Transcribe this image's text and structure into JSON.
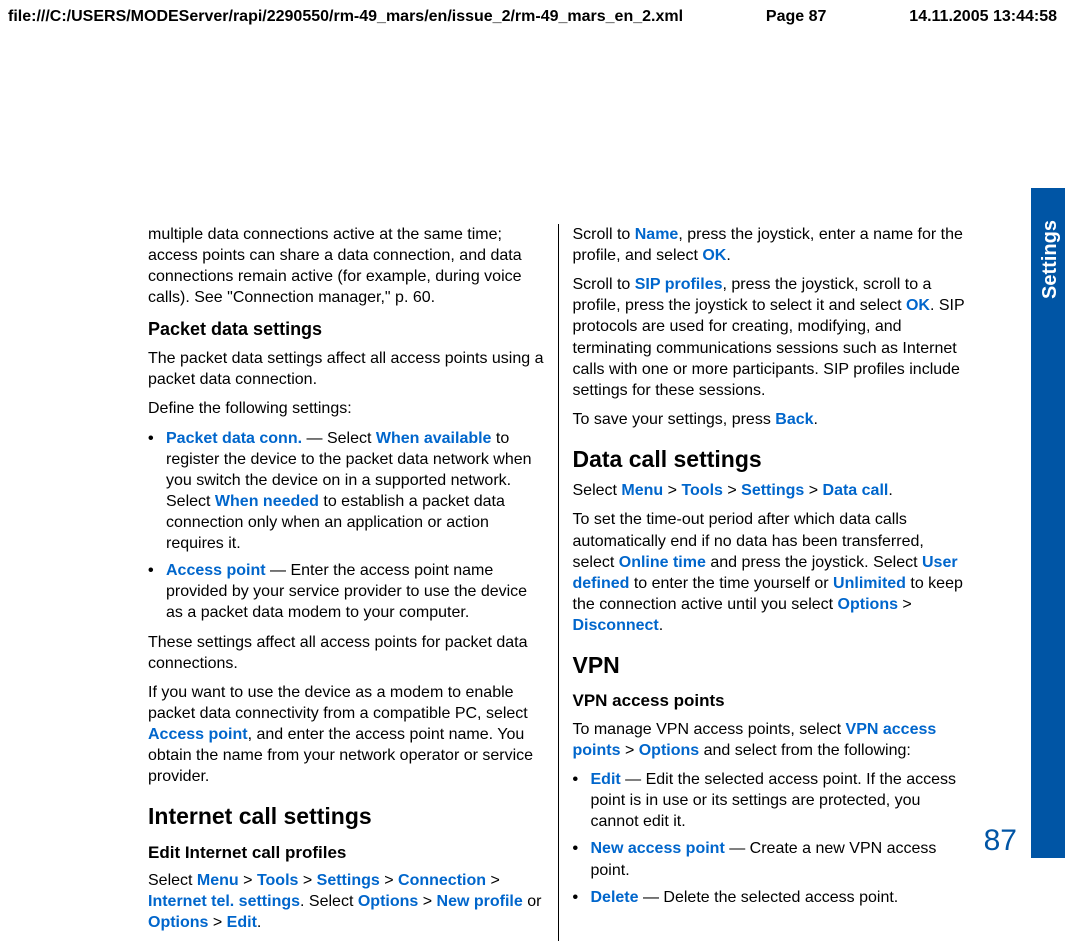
{
  "header": {
    "path": "file:///C:/USERS/MODEServer/rapi/2290550/rm-49_mars/en/issue_2/rm-49_mars_en_2.xml",
    "page": "Page 87",
    "ts": "14.11.2005 13:44:58"
  },
  "side": {
    "tab": "Settings",
    "num": "87"
  },
  "L": {
    "p1": "multiple data connections active at the same time; access points can share a data connection, and data connections remain active (for example, during voice calls). See \"Connection manager,\" p. 60.",
    "h3_pds": "Packet data settings",
    "p2": "The packet data settings affect all access points using a packet data connection.",
    "p3": "Define the following settings:",
    "li1a": "Packet data conn.",
    "li1b": " — Select ",
    "li1c": "When available",
    "li1d": " to register the device to the packet data network when you switch the device on in a supported network. Select ",
    "li1e": "When needed",
    "li1f": " to establish a packet data connection only when an application or action requires it.",
    "li2a": "Access point",
    "li2b": " — Enter the access point name provided by your service provider to use the device as a packet data modem to your computer.",
    "p4": "These settings affect all access points for packet data connections.",
    "p5a": "If you want to use the device as a modem to enable packet data connectivity from a compatible PC, select ",
    "p5b": "Access point",
    "p5c": ", and enter the access point name. You obtain the name from your network operator or service provider.",
    "h2_ics": "Internet call settings",
    "h4_eicp": "Edit Internet call profiles",
    "p6a": "Select ",
    "p6b": "Menu",
    "p6c": " > ",
    "p6d": "Tools",
    "p6e": " > ",
    "p6f": "Settings",
    "p6g": " > ",
    "p6h": "Connection",
    "p6i": " > ",
    "p6j": "Internet tel. settings",
    "p6k": ". Select ",
    "p6l": "Options",
    "p6m": " > ",
    "p6n": "New profile",
    "p6o": " or ",
    "p6p": "Options",
    "p6q": " > ",
    "p6r": "Edit",
    "p6s": "."
  },
  "R": {
    "p1a": "Scroll to ",
    "p1b": "Name",
    "p1c": ", press the joystick, enter a name for the profile, and select ",
    "p1d": "OK",
    "p1e": ".",
    "p2a": "Scroll to ",
    "p2b": "SIP profiles",
    "p2c": ", press the joystick, scroll to a profile, press the joystick to select it and select ",
    "p2d": "OK",
    "p2e": ". SIP protocols are used for creating, modifying, and terminating communications sessions such as Internet calls with one or more participants. SIP profiles include settings for these sessions.",
    "p3a": "To save your settings, press ",
    "p3b": "Back",
    "p3c": ".",
    "h2_dcs": "Data call settings",
    "p4a": "Select ",
    "p4b": "Menu",
    "p4c": " > ",
    "p4d": "Tools",
    "p4e": " > ",
    "p4f": "Settings",
    "p4g": " > ",
    "p4h": "Data call",
    "p4i": ".",
    "p5a": "To set the time-out period after which data calls automatically end if no data has been transferred, select ",
    "p5b": "Online time",
    "p5c": " and press the joystick. Select ",
    "p5d": "User defined",
    "p5e": " to enter the time yourself or ",
    "p5f": "Unlimited",
    "p5g": " to keep the connection active until you select ",
    "p5h": "Options",
    "p5i": " > ",
    "p5j": "Disconnect",
    "p5k": ".",
    "h2_vpn": "VPN",
    "h4_vap": "VPN access points",
    "p6a": "To manage VPN access points, select ",
    "p6b": "VPN access points",
    "p6c": " > ",
    "p6d": "Options",
    "p6e": " and select from the following:",
    "li1a": "Edit",
    "li1b": " — Edit the selected access point. If the access point is in use or its settings are protected, you cannot edit it.",
    "li2a": "New access point",
    "li2b": " — Create a new VPN access point.",
    "li3a": "Delete",
    "li3b": " — Delete the selected access point."
  }
}
